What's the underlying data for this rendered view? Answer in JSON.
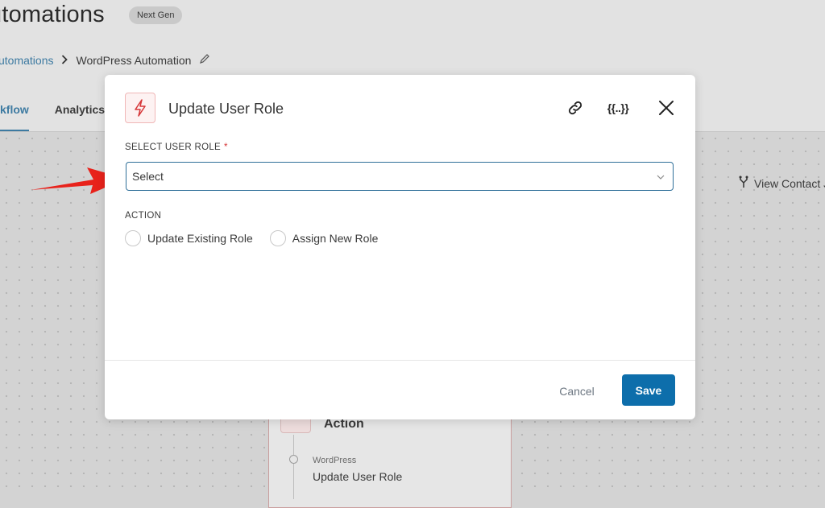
{
  "page": {
    "title": "utomations",
    "badge": "Next Gen",
    "breadcrumb": {
      "link": "utomations",
      "current": "WordPress Automation"
    },
    "tabs": [
      {
        "label": "kflow",
        "active": true
      },
      {
        "label": "Analytics",
        "active": false
      }
    ],
    "view_contact": "View Contact J",
    "node": {
      "title": "Action",
      "sub": "WordPress",
      "main": "Update User Role"
    }
  },
  "modal": {
    "title": "Update User Role",
    "merge_tag": "{{..}}",
    "select_label": "SELECT USER ROLE",
    "required_marker": "*",
    "select_value": "Select",
    "action_label": "ACTION",
    "radio_options": [
      "Update Existing Role",
      "Assign New Role"
    ],
    "cancel": "Cancel",
    "save": "Save"
  },
  "colors": {
    "accent": "#0d6eab",
    "icon": "#d63638",
    "arrow": "#e8221b"
  },
  "icons": [
    "bolt-icon",
    "link-icon",
    "merge-tags-icon",
    "close-icon",
    "chevron-down-icon",
    "edit-icon",
    "fork-icon"
  ]
}
